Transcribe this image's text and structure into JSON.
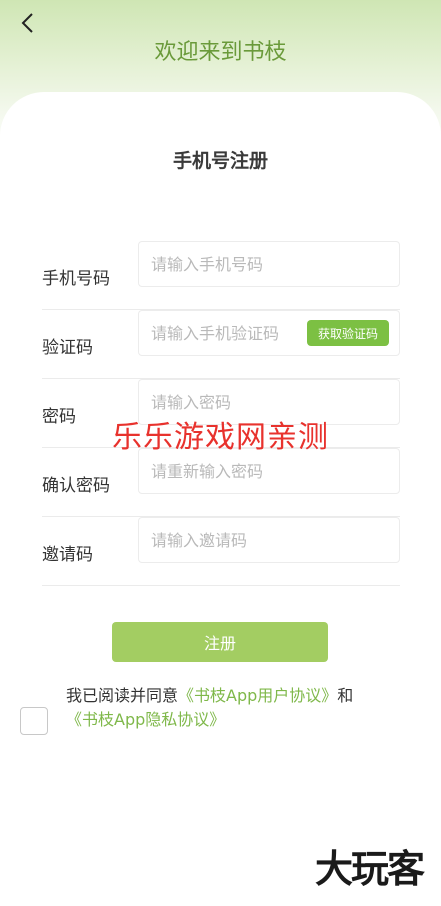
{
  "header": {
    "title": "欢迎来到书枝"
  },
  "form": {
    "title": "手机号注册",
    "phone": {
      "label": "手机号码",
      "placeholder": "请输入手机号码"
    },
    "code": {
      "label": "验证码",
      "placeholder": "请输入手机验证码",
      "button": "获取验证码"
    },
    "password": {
      "label": "密码",
      "placeholder": "请输入密码"
    },
    "confirm": {
      "label": "确认密码",
      "placeholder": "请重新输入密码"
    },
    "invite": {
      "label": "邀请码",
      "placeholder": "请输入邀请码"
    },
    "submit": "注册"
  },
  "agreement": {
    "prefix": "我已阅读并同意",
    "user_link": "《书枝App用户协议》",
    "conjunction": "和",
    "privacy_link": "《书枝App隐私协议》"
  },
  "overlays": {
    "watermark": "乐乐游戏网亲测",
    "brand": "大玩客"
  },
  "colors": {
    "accent": "#7cc043",
    "submit": "#a3cd62",
    "title_green": "#6a9a3a",
    "watermark_red": "#e8322d"
  }
}
